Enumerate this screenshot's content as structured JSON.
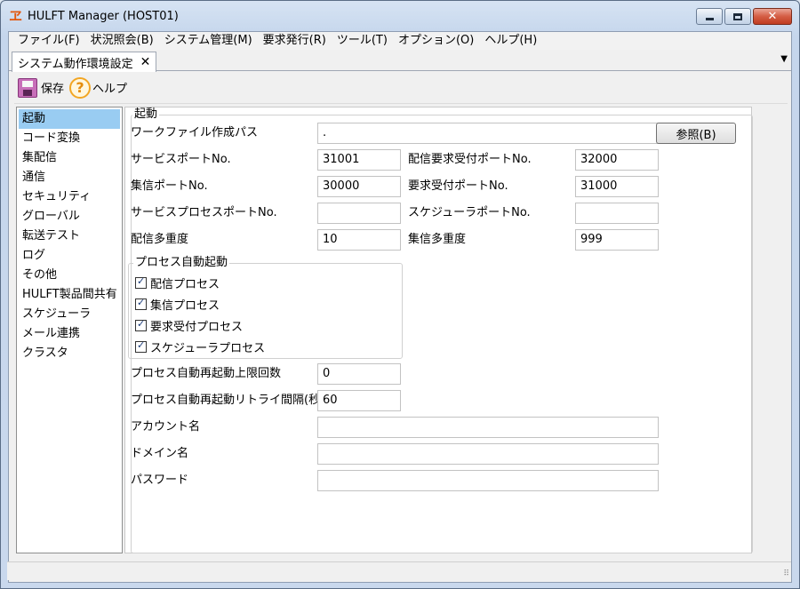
{
  "window": {
    "title": "HULFT Manager (HOST01)",
    "icon": "hulft-app-icon",
    "controls": {
      "minimize": "minimize-icon",
      "maximize": "maximize-icon",
      "close": "✕"
    }
  },
  "menubar": {
    "items": [
      "ファイル(F)",
      "状況照会(B)",
      "システム管理(M)",
      "要求発行(R)",
      "ツール(T)",
      "オプション(O)",
      "ヘルプ(H)"
    ]
  },
  "tab": {
    "label": "システム動作環境設定",
    "close": "✕",
    "menu": "▼"
  },
  "toolbar": {
    "save_label": "保存",
    "help_label": "ヘルプ",
    "help_glyph": "?"
  },
  "sidebar": {
    "items": [
      "起動",
      "コード変換",
      "集配信",
      "通信",
      "セキュリティ",
      "グローバル",
      "転送テスト",
      "ログ",
      "その他",
      "HULFT製品間共有",
      "スケジューラ",
      "メール連携",
      "クラスタ"
    ],
    "selected": 0
  },
  "form": {
    "group_title": "起動",
    "work_path_label": "ワークファイル作成パス",
    "work_path_value": ".",
    "browse_label": "参照(B)",
    "service_port_label": "サービスポートNo.",
    "service_port_value": "31001",
    "send_req_port_label": "配信要求受付ポートNo.",
    "send_req_port_value": "32000",
    "recv_port_label": "集信ポートNo.",
    "recv_port_value": "30000",
    "req_port_label": "要求受付ポートNo.",
    "req_port_value": "31000",
    "service_proc_port_label": "サービスプロセスポートNo.",
    "service_proc_port_value": "",
    "scheduler_port_label": "スケジューラポートNo.",
    "scheduler_port_value": "",
    "send_multi_label": "配信多重度",
    "send_multi_value": "10",
    "recv_multi_label": "集信多重度",
    "recv_multi_value": "999",
    "proc_group_title": "プロセス自動起動",
    "proc_items": [
      "配信プロセス",
      "集信プロセス",
      "要求受付プロセス",
      "スケジューラプロセス"
    ],
    "restart_limit_label": "プロセス自動再起動上限回数",
    "restart_limit_value": "0",
    "restart_interval_label": "プロセス自動再起動リトライ間隔(秒)",
    "restart_interval_value": "60",
    "account_label": "アカウント名",
    "account_value": "",
    "domain_label": "ドメイン名",
    "domain_value": "",
    "password_label": "パスワード",
    "password_value": ""
  },
  "statusbar": {
    "grip": "⠿"
  }
}
